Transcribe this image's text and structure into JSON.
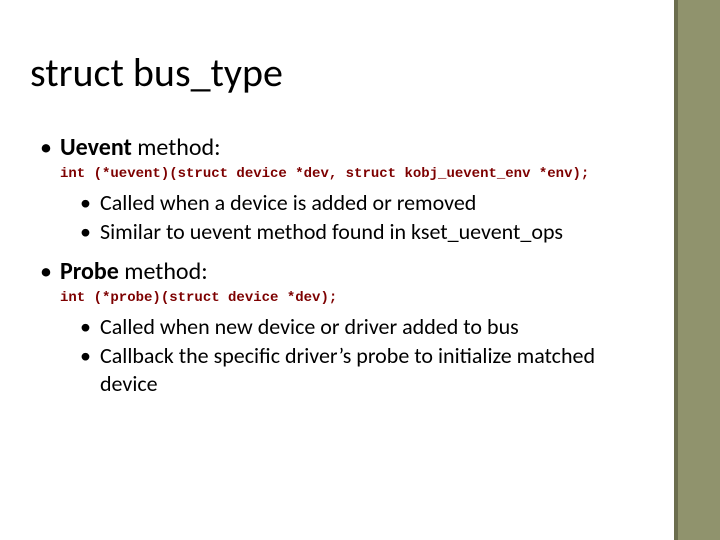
{
  "title": "struct bus_type",
  "items": {
    "uevent_heading_bold": "Uevent",
    "uevent_heading_rest": " method:",
    "uevent_code": "int (*uevent)(struct device *dev, struct kobj_uevent_env *env);",
    "uevent_sub1": "Called when a device is added or removed",
    "uevent_sub2": "Similar to uevent method found in kset_uevent_ops",
    "probe_heading_bold": "Probe",
    "probe_heading_rest": " method:",
    "probe_code": "int (*probe)(struct device *dev);",
    "probe_sub1": "Called when new device or driver added to bus",
    "probe_sub2": "Callback the specific driver’s probe to initialize matched device"
  }
}
